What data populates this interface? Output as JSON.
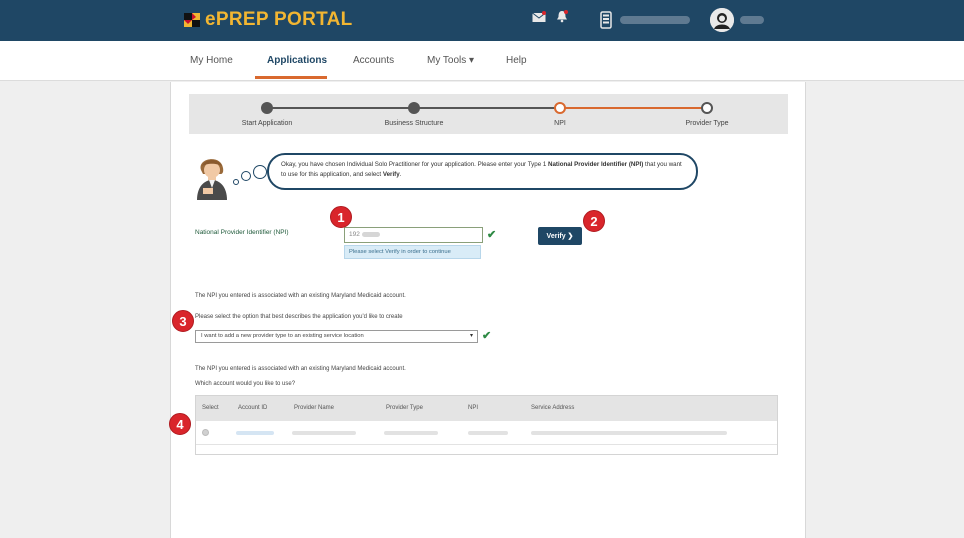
{
  "header": {
    "app_name": "ePREP PORTAL",
    "icons": [
      "logo-flag-icon",
      "mail-icon",
      "bell-icon",
      "tablet-icon",
      "user-avatar-icon"
    ],
    "colors": {
      "bar": "#1f4765",
      "brand_text": "#f2b632"
    }
  },
  "nav": {
    "items": [
      {
        "label": "My Home"
      },
      {
        "label": "Applications"
      },
      {
        "label": "Accounts"
      },
      {
        "label": "My Tools ▾"
      },
      {
        "label": "Help"
      }
    ],
    "active": "Applications",
    "accent": "#d9692f"
  },
  "stepper": {
    "steps": [
      {
        "label": "Start Application",
        "state": "complete"
      },
      {
        "label": "Business Structure",
        "state": "complete"
      },
      {
        "label": "NPI",
        "state": "current"
      },
      {
        "label": "Provider Type",
        "state": "pending"
      }
    ],
    "current_color": "#d9692f"
  },
  "assistant": {
    "text_part1": "Okay, you have chosen Individual Solo Practitioner for your application. Please enter your Type 1 ",
    "text_bold": "National Provider Identifier (NPI)",
    "text_part2": " that you want to use for this application, and select ",
    "text_bold2": "Verify",
    "text_end": "."
  },
  "npi": {
    "label": "National Provider Identifier (NPI)",
    "value": "192",
    "hint": "Please select Verify in order to continue",
    "verify_label": "Verify ❯"
  },
  "badges": [
    "1",
    "2",
    "3",
    "4"
  ],
  "account_section": {
    "notice1": "The NPI you entered is associated with an existing Maryland Medicaid account.",
    "prompt_select": "Please select the option that best describes the application you'd like to create",
    "selected_option": "I want to add a new provider type to an existing service location",
    "notice2": "The NPI you entered is associated with an existing Maryland Medicaid account.",
    "prompt_account": "Which account would you like to use?"
  },
  "table": {
    "columns": [
      "Select",
      "Account ID",
      "Provider Name",
      "Provider Type",
      "NPI",
      "Service Address"
    ]
  }
}
